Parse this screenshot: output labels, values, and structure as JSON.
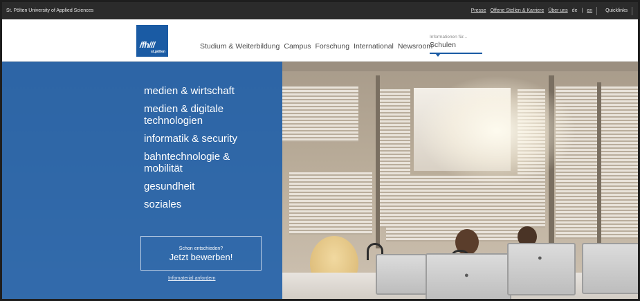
{
  "topbar": {
    "university": "St. Pölten University of Applied Sciences",
    "links": [
      {
        "label": "Presse"
      },
      {
        "label": "Offene Stellen & Karriere"
      },
      {
        "label": "Über uns"
      }
    ],
    "lang_de": "de",
    "lang_sep": "|",
    "lang_en": "en",
    "quicklinks": "Quicklinks"
  },
  "header": {
    "logo_mark": "/fh///",
    "logo_sub": "st.pölten",
    "nav": [
      {
        "label": "Studium & Weiterbildung"
      },
      {
        "label": "Campus"
      },
      {
        "label": "Forschung"
      },
      {
        "label": "International"
      },
      {
        "label": "Newsroom"
      }
    ],
    "info_small": "Informationen für...",
    "info_selected": "Schulen"
  },
  "hero": {
    "menu": [
      {
        "label": "medien & wirtschaft"
      },
      {
        "label": "medien & digitale technologien"
      },
      {
        "label": "informatik & security"
      },
      {
        "label": "bahntechnologie & mobilität"
      },
      {
        "label": "gesundheit"
      },
      {
        "label": "soziales"
      }
    ],
    "cta_small": "Schon entschieden?",
    "cta_big": "Jetzt bewerben!",
    "info_link": "Infomaterial anfordern"
  },
  "colors": {
    "brand_blue": "#1a5ba4",
    "topbar_bg": "#2b2b2b"
  }
}
